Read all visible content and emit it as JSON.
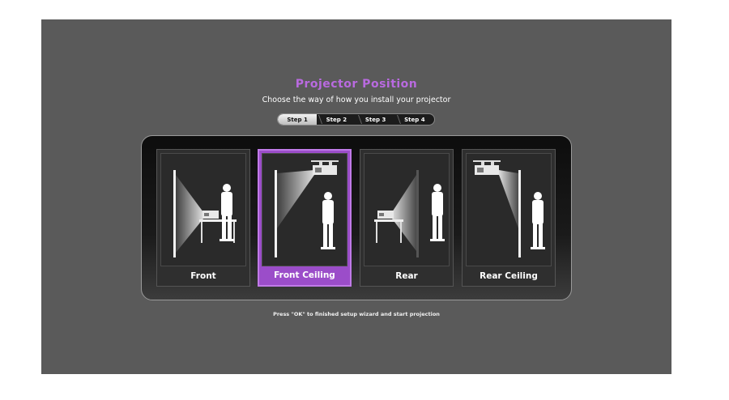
{
  "title": "Projector Position",
  "subtitle": "Choose the way of how you install your projector",
  "steps": [
    {
      "label": "Step 1",
      "active": true
    },
    {
      "label": "Step 2",
      "active": false
    },
    {
      "label": "Step 3",
      "active": false
    },
    {
      "label": "Step 4",
      "active": false
    }
  ],
  "options": [
    {
      "label": "Front",
      "selected": false
    },
    {
      "label": "Front Ceiling",
      "selected": true
    },
    {
      "label": "Rear",
      "selected": false
    },
    {
      "label": "Rear Ceiling",
      "selected": false
    }
  ],
  "footer": "Press \"OK\" to finished setup wizard and start projection",
  "colors": {
    "accent": "#9b4dc9",
    "title": "#b96ae0",
    "background": "#5a5a5a"
  }
}
